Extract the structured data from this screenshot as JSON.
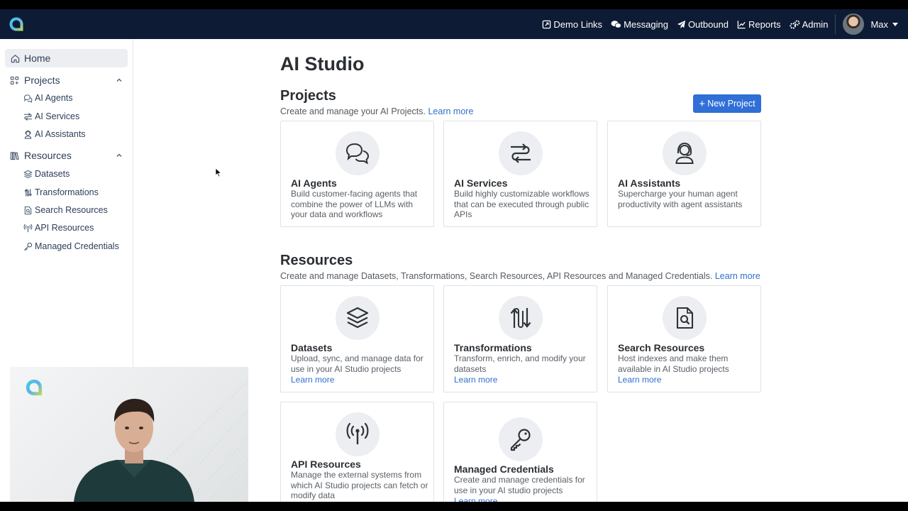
{
  "nav": {
    "links": [
      "Demo Links",
      "Messaging",
      "Outbound",
      "Reports",
      "Admin"
    ],
    "user_name": "Max"
  },
  "sidebar": {
    "home": "Home",
    "projects_label": "Projects",
    "projects_items": [
      "AI Agents",
      "AI Services",
      "AI Assistants"
    ],
    "resources_label": "Resources",
    "resources_items": [
      "Datasets",
      "Transformations",
      "Search Resources",
      "API Resources",
      "Managed Credentials"
    ]
  },
  "main": {
    "title": "AI Studio",
    "projects": {
      "title": "Projects",
      "desc": "Create and manage your AI Projects.",
      "learn_more": "Learn more",
      "new_button": "New Project",
      "cards": [
        {
          "title": "AI Agents",
          "desc": "Build customer-facing agents that combine the power of LLMs with your data and workflows",
          "icon": "chat-bubbles-icon"
        },
        {
          "title": "AI Services",
          "desc": "Build highly customizable workflows that can be executed through public APIs",
          "icon": "route-icon"
        },
        {
          "title": "AI Assistants",
          "desc": "Supercharge your human agent productivity with agent assistants",
          "icon": "headset-agent-icon"
        }
      ]
    },
    "resources": {
      "title": "Resources",
      "desc": "Create and manage Datasets, Transformations, Search Resources, API Resources and Managed Credentials.",
      "learn_more": "Learn more",
      "cards": [
        {
          "title": "Datasets",
          "desc": "Upload, sync, and manage data for use in your AI Studio projects",
          "link": "Learn more",
          "icon": "layers-icon"
        },
        {
          "title": "Transformations",
          "desc": "Transform, enrich, and modify your datasets",
          "link": "Learn more",
          "icon": "arrows-transform-icon"
        },
        {
          "title": "Search Resources",
          "desc": "Host indexes and make them available in AI Studio projects",
          "link": "Learn more",
          "icon": "file-search-icon"
        },
        {
          "title": "API Resources",
          "desc": "Manage the external systems from which AI Studio projects can fetch or modify data",
          "link": "",
          "icon": "antenna-icon"
        },
        {
          "title": "Managed Credentials",
          "desc": "Create and manage credentials for use in your AI studio projects",
          "link": "Learn more",
          "icon": "key-icon"
        }
      ]
    }
  },
  "colors": {
    "nav_bg": "#0d1b34",
    "accent": "#2f6fd6",
    "link": "#2f6fce"
  }
}
